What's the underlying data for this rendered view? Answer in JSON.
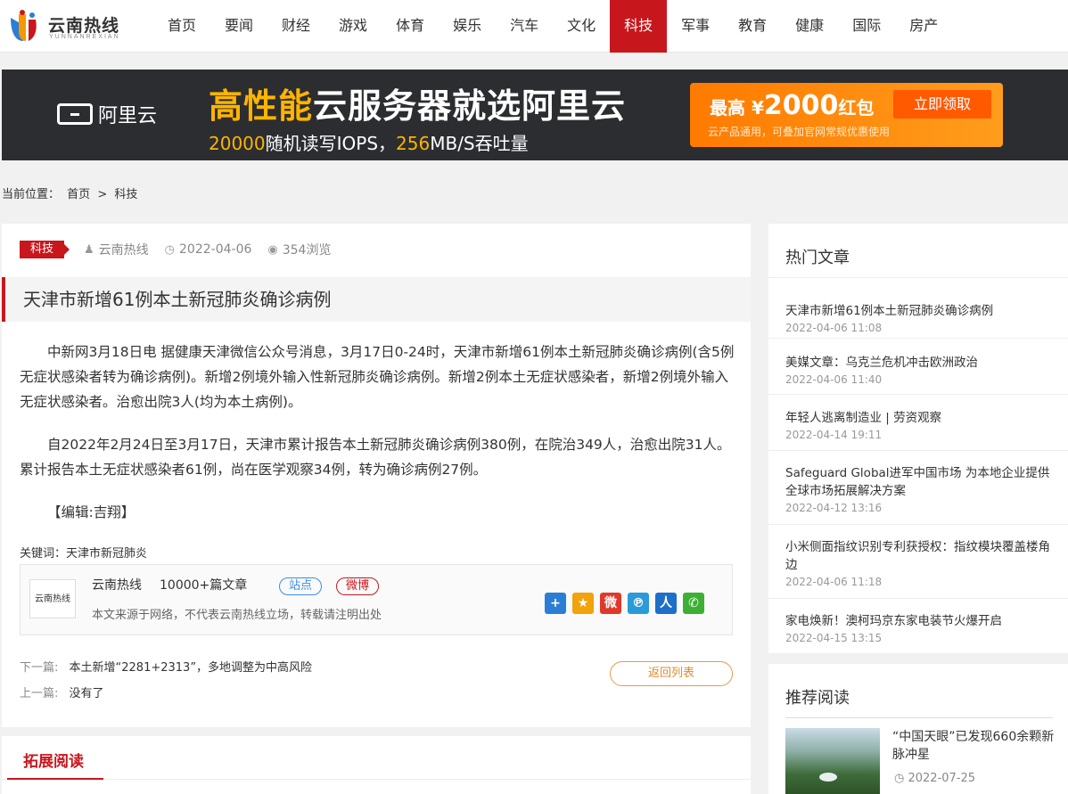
{
  "site": {
    "name": "云南热线",
    "name_en": "YUNNANREXIAN"
  },
  "nav": [
    {
      "label": "首页"
    },
    {
      "label": "要闻"
    },
    {
      "label": "财经"
    },
    {
      "label": "游戏"
    },
    {
      "label": "体育"
    },
    {
      "label": "娱乐"
    },
    {
      "label": "汽车"
    },
    {
      "label": "文化"
    },
    {
      "label": "科技",
      "active": true
    },
    {
      "label": "军事"
    },
    {
      "label": "教育"
    },
    {
      "label": "健康"
    },
    {
      "label": "国际"
    },
    {
      "label": "房产"
    }
  ],
  "banner": {
    "brand": "阿里云",
    "headline_hl": "高性能",
    "headline_rest": "云服务器就选阿里云",
    "sub_a": "20000",
    "sub_b": "随机读写IOPS，",
    "sub_c": "256",
    "sub_d": "MB/S吞吐量",
    "cta_prefix": "最高 ¥",
    "cta_amount": "2000",
    "cta_suffix": "红包",
    "cta_note": "云产品通用，可叠加官网常规优惠使用",
    "cta_button": "立即领取"
  },
  "breadcrumb": {
    "prefix": "当前位置：",
    "home": "首页",
    "sep": ">",
    "current": "科技"
  },
  "article": {
    "tag": "科技",
    "author": "云南热线",
    "date": "2022-04-06",
    "views": "354浏览",
    "title": "天津市新增61例本土新冠肺炎确诊病例",
    "paragraphs": [
      "中新网3月18日电 据健康天津微信公众号消息，3月17日0-24时，天津市新增61例本土新冠肺炎确诊病例(含5例无症状感染者转为确诊病例)。新增2例境外输入性新冠肺炎确诊病例。新增2例本土无症状感染者，新增2例境外输入无症状感染者。治愈出院3人(均为本土病例)。",
      "自2022年2月24日至3月17日，天津市累计报告本土新冠肺炎确诊病例380例，在院治349人，治愈出院31人。累计报告本土无症状感染者61例，尚在医学观察34例，转为确诊病例27例。",
      "【编辑:吉翔】"
    ],
    "keywords": "关键词：天津市新冠肺炎",
    "source": {
      "logo_text": "云南热线",
      "name": "云南热线",
      "count": "10000+篇文章",
      "pill_site": "站点",
      "pill_weibo": "微博",
      "note": "本文来源于网络，不代表云南热线立场，转载请注明出处"
    },
    "share_icons": [
      {
        "icon": "plus-share-icon",
        "glyph": "+",
        "color": "#2a7fd4"
      },
      {
        "icon": "qzone-icon",
        "glyph": "★",
        "color": "#f0a30a"
      },
      {
        "icon": "weibo-icon",
        "glyph": "微",
        "color": "#e0392b"
      },
      {
        "icon": "tencent-weibo-icon",
        "glyph": "℗",
        "color": "#2b9ad8"
      },
      {
        "icon": "renren-icon",
        "glyph": "人",
        "color": "#1e6fc8"
      },
      {
        "icon": "wechat-icon",
        "glyph": "✆",
        "color": "#3cb034"
      }
    ],
    "next_label": "下一篇:",
    "next_title": "本土新增“2281+2313”，多地调整为中高风险",
    "prev_label": "上一篇:",
    "prev_title": "没有了",
    "back_button": "返回列表"
  },
  "extended": {
    "title": "拓展阅读"
  },
  "hot": {
    "title": "热门文章",
    "items": [
      {
        "title": "天津市新增61例本土新冠肺炎确诊病例",
        "date": "2022-04-06 11:08"
      },
      {
        "title": "美媒文章：乌克兰危机冲击欧洲政治",
        "date": "2022-04-06 11:40"
      },
      {
        "title": "年轻人逃离制造业 | 劳资观察",
        "date": "2022-04-14 19:11"
      },
      {
        "title": "Safeguard Global进军中国市场 为本地企业提供全球市场拓展解决方案",
        "date": "2022-04-12 13:16"
      },
      {
        "title": "小米侧面指纹识别专利获授权：指纹模块覆盖楼角边",
        "date": "2022-04-06 11:18"
      },
      {
        "title": "家电焕新！澳柯玛京东家电装节火爆开启",
        "date": "2022-04-15 13:15"
      }
    ]
  },
  "recommend": {
    "title": "推荐阅读",
    "item_title": "“中国天眼”已发现660余颗新脉冲星",
    "item_date": "2022-07-25"
  },
  "colors": {
    "brand_red": "#c8161d",
    "banner_bg": "#2b2d30",
    "accent_orange": "#ff7a00"
  }
}
